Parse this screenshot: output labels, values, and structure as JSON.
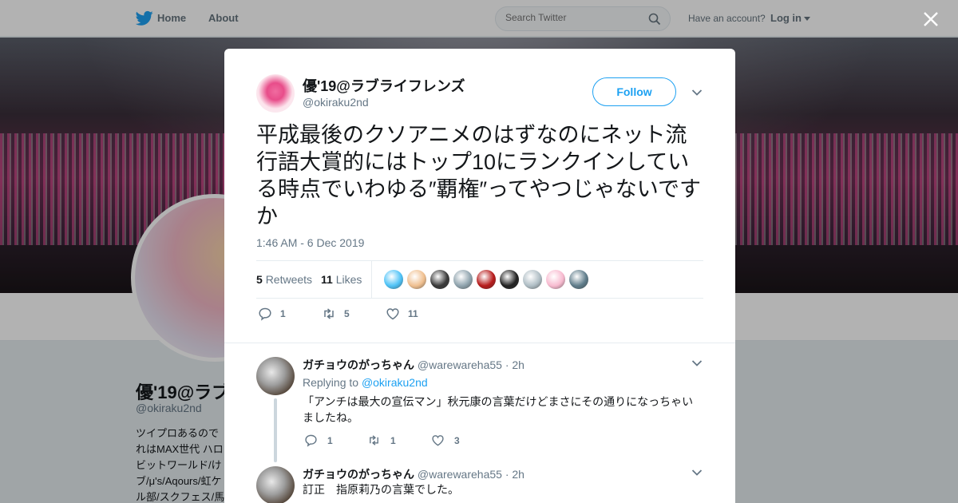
{
  "topbar": {
    "home_label": "Home",
    "about_label": "About",
    "search_placeholder": "Search Twitter",
    "account_prompt": "Have an account?",
    "login_label": "Log in"
  },
  "profile": {
    "name": "優'19@ラブ",
    "handle": "@okiraku2nd",
    "bio_lines": [
      "ツイプロあるので",
      "れはMAX世代 ハロ",
      "ビットワールド/け",
      "ブ/μ's/Aqours/虹ケ",
      "ル部/スクフェス/馬"
    ]
  },
  "tweet": {
    "author_name": "優'19@ラブライフレンズ",
    "author_handle": "@okiraku2nd",
    "follow_label": "Follow",
    "text": "平成最後のクソアニメのはずなのにネット流行語大賞的にはトップ10にランクインしている時点でいわゆる″覇権″ってやつじゃないですか",
    "timestamp": "1:46 AM - 6 Dec 2019",
    "retweets_count": "5",
    "retweets_label": "Retweets",
    "likes_count": "11",
    "likes_label": "Likes",
    "likers_colors": [
      "#4fc3f7",
      "#f0c090",
      "#3a3a3a",
      "#90a4ae",
      "#b71c1c",
      "#222222",
      "#b0bec5",
      "#f8bbd0",
      "#607d8b"
    ],
    "actions": {
      "replies": "1",
      "retweets": "5",
      "likes": "11"
    }
  },
  "replies": [
    {
      "name": "ガチョウのがっちゃん",
      "handle": "@warewareha55",
      "time": "· 2h",
      "replying_prefix": "Replying to",
      "replying_to": "@okiraku2nd",
      "text": "「アンチは最大の宣伝マン」秋元康の言葉だけどまさにその通りになっちゃいましたね。",
      "replies": "1",
      "retweets": "1",
      "likes": "3"
    },
    {
      "name": "ガチョウのがっちゃん",
      "handle": "@warewareha55",
      "time": "· 2h",
      "text": "訂正　指原莉乃の言葉でした。"
    }
  ],
  "colors": {
    "accent": "#1da1f2",
    "muted": "#657786",
    "text": "#14171a"
  }
}
